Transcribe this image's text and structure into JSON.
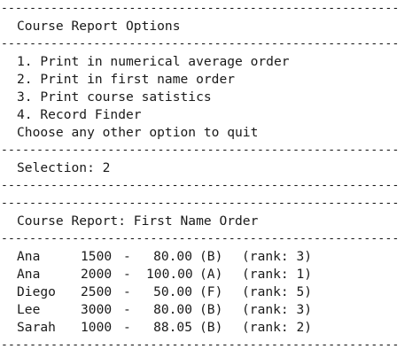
{
  "rule": "----------------------------------------------------------------------",
  "header": {
    "title": "Course Report Options"
  },
  "menu": {
    "items": [
      "1. Print in numerical average order",
      "2. Print in first name order",
      "3. Print course satistics",
      "4. Record Finder"
    ],
    "quit_hint": "Choose any other option to quit"
  },
  "selection": {
    "text": "Selection: 2"
  },
  "report": {
    "title": "Course Report: First Name Order",
    "rows": [
      {
        "name": "Ana",
        "id": "1500",
        "sep": "-",
        "avg": "80.00",
        "grade": "(B)",
        "rank": "(rank: 3)"
      },
      {
        "name": "Ana",
        "id": "2000",
        "sep": "-",
        "avg": "100.00",
        "grade": "(A)",
        "rank": "(rank: 1)"
      },
      {
        "name": "Diego",
        "id": "2500",
        "sep": "-",
        "avg": "50.00",
        "grade": "(F)",
        "rank": "(rank: 5)"
      },
      {
        "name": "Lee",
        "id": "3000",
        "sep": "-",
        "avg": "80.00",
        "grade": "(B)",
        "rank": "(rank: 3)"
      },
      {
        "name": "Sarah",
        "id": "1000",
        "sep": "-",
        "avg": "88.05",
        "grade": "(B)",
        "rank": "(rank: 2)"
      }
    ]
  }
}
